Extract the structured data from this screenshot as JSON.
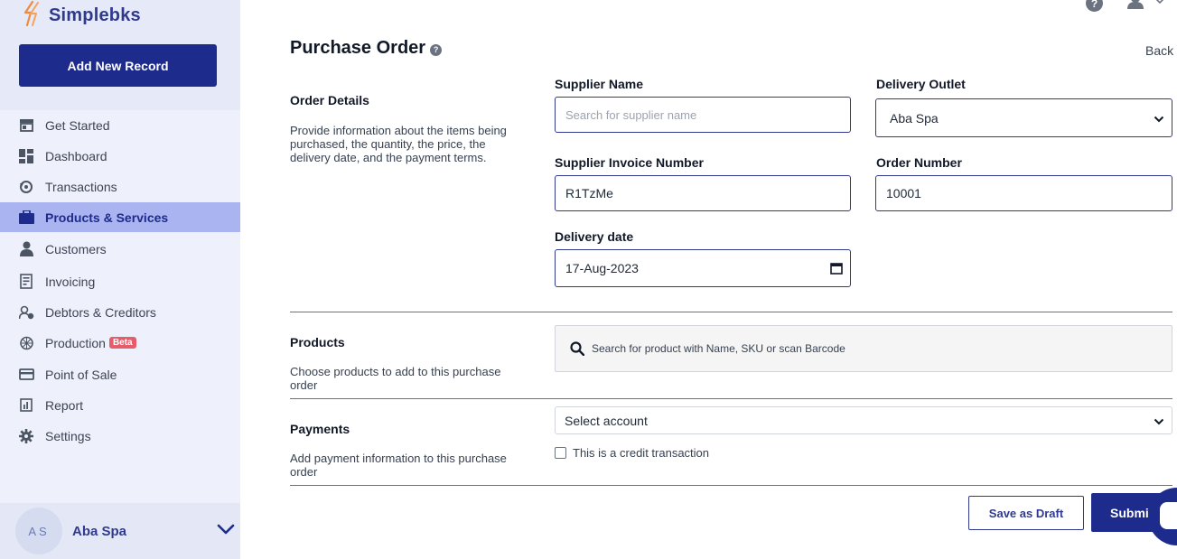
{
  "app": {
    "logo_text": "Simplebks",
    "add_new_label": "Add New Record"
  },
  "sidebar": {
    "items": [
      {
        "label": "Get Started",
        "icon": "store-icon"
      },
      {
        "label": "Dashboard",
        "icon": "dashboard-grid-icon"
      },
      {
        "label": "Transactions",
        "icon": "exchange-icon"
      },
      {
        "label": "Products & Services",
        "icon": "briefcase-icon",
        "active": true
      },
      {
        "label": "Customers",
        "icon": "person-icon"
      },
      {
        "label": "Invoicing",
        "icon": "receipt-icon"
      },
      {
        "label": "Debtors & Creditors",
        "icon": "debtors-icon"
      },
      {
        "label": "Production",
        "icon": "production-icon",
        "badge": "Beta"
      },
      {
        "label": "Point of Sale",
        "icon": "card-icon"
      },
      {
        "label": "Report",
        "icon": "report-icon"
      },
      {
        "label": "Settings",
        "icon": "gear-icon"
      }
    ],
    "account": {
      "initials": "AS",
      "name": "Aba Spa"
    }
  },
  "header": {
    "help_symbol": "?"
  },
  "page": {
    "title": "Purchase Order",
    "title_help_symbol": "?",
    "back_label": "Back"
  },
  "order_details": {
    "title": "Order Details",
    "description": "Provide information about the items being purchased, the quantity, the price, the delivery date, and the payment terms.",
    "supplier_name_label": "Supplier Name",
    "supplier_name_placeholder": "Search for supplier name",
    "delivery_outlet_label": "Delivery Outlet",
    "delivery_outlet_value": "Aba Spa",
    "invoice_number_label": "Supplier Invoice Number",
    "invoice_number_value": "R1TzMe",
    "order_number_label": "Order Number",
    "order_number_value": "10001",
    "delivery_date_label": "Delivery date",
    "delivery_date_value": "17-Aug-2023"
  },
  "products": {
    "title": "Products",
    "description": "Choose products to add to this purchase order",
    "search_placeholder": "Search for product with Name, SKU or scan Barcode"
  },
  "payments": {
    "title": "Payments",
    "description": "Add payment information to this purchase order",
    "account_select_value": "Select account",
    "credit_label": "This is a credit transaction",
    "credit_checked": false
  },
  "actions": {
    "save_draft_label": "Save as Draft",
    "submit_label": "Submit"
  },
  "colors": {
    "primary": "#1d2b8c",
    "active_nav": "#aab4f1",
    "beta_badge": "#e35d6a",
    "sidebar_bg": "#eef1fb"
  }
}
